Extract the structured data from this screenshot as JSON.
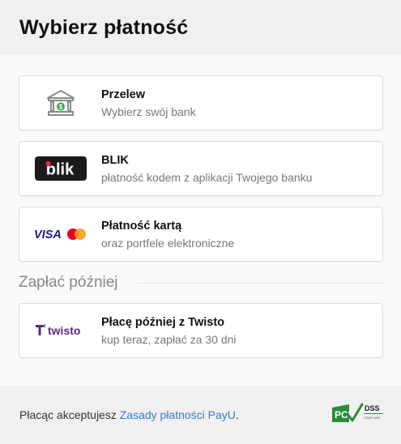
{
  "header": {
    "title": "Wybierz płatność"
  },
  "methods": [
    {
      "title": "Przelew",
      "subtitle": "Wybierz swój bank",
      "logo": "bank-icon"
    },
    {
      "title": "BLIK",
      "subtitle": "płatność kodem z aplikacji Twojego banku",
      "logo": "blik-logo",
      "logo_text": "blik"
    },
    {
      "title": "Płatność kartą",
      "subtitle": "oraz portfele elektroniczne",
      "logo": "visa-mastercard-logo",
      "logo_text": "VISA"
    }
  ],
  "later": {
    "heading": "Zapłać później",
    "method": {
      "title": "Płacę później z Twisto",
      "subtitle": "kup teraz, zapłać za 30 dni",
      "logo": "twisto-logo",
      "logo_text": "twisto"
    }
  },
  "footer": {
    "prefix": "Płacąc akceptujesz ",
    "link": "Zasady płatności PayU",
    "suffix": ".",
    "badge": "PCI DSS compliant"
  },
  "colors": {
    "blik_bg": "#1b1b1b",
    "visa_blue": "#1a1f71",
    "mastercard_red": "#eb001b",
    "mastercard_orange": "#f79e1b",
    "twisto_purple": "#5a2a7a",
    "twisto_green": "#2fb44a",
    "link_blue": "#3a79c4",
    "pci_green": "#2a8c3a"
  }
}
